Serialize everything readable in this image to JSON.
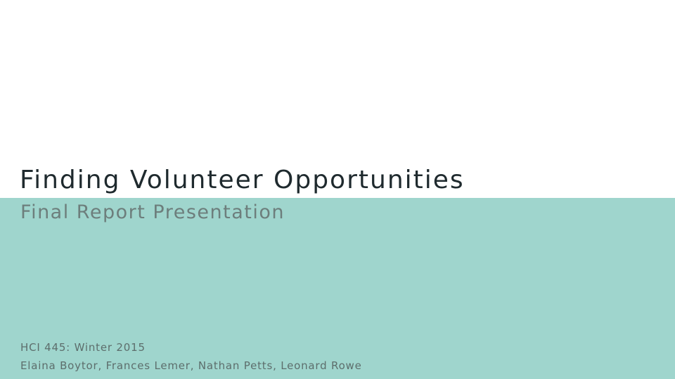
{
  "slide": {
    "title": "Finding Volunteer Opportunities",
    "subtitle": "Final Report Presentation",
    "course": "HCI 445: Winter 2015",
    "authors": "Elaina Boytor, Frances Lemer, Nathan Petts, Leonard Rowe"
  },
  "colors": {
    "band": "#9fd5cd",
    "title_text": "#1f2a2e",
    "subtitle_text": "#6d7e7c",
    "footer_text": "#5d6e6c"
  }
}
